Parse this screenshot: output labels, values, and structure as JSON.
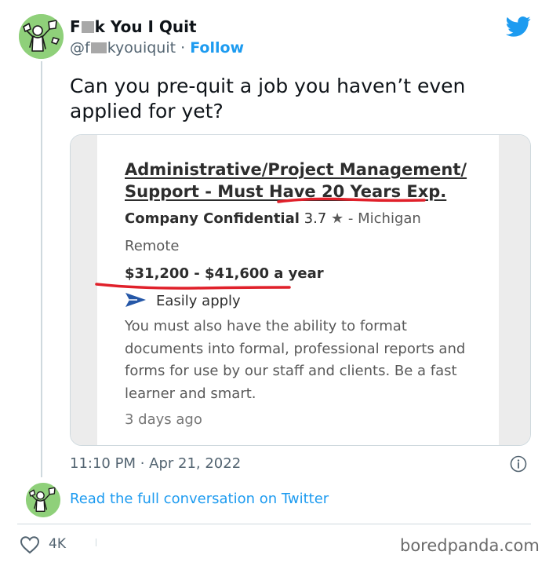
{
  "tweet": {
    "display_name": {
      "before": "F",
      "after": "k You I Quit"
    },
    "handle": {
      "before": "@f",
      "after": "kyouiquit"
    },
    "separator": " · ",
    "follow_label": "Follow",
    "text": "Can you pre-quit a job you haven’t even applied for yet?",
    "timestamp": "11:10 PM · Apr 21, 2022",
    "read_more": "Read the full conversation on Twitter",
    "likes": "4K"
  },
  "job_card": {
    "title": "Administrative/Project Management/ Support - Must Have 20 Years Exp.",
    "company": "Company Confidential",
    "rating": "3.7",
    "location": "- Michigan",
    "work_type": "Remote",
    "salary": "$31,200 - $41,600 a year",
    "apply_label": "Easily apply",
    "description": "You must also have the ability to format documents into formal, professional reports and forms for use by our staff and clients. Be a fast learner and smart.",
    "posted": "3 days ago"
  },
  "watermark": "boredpanda.com",
  "colors": {
    "twitter_blue": "#1d9bf0",
    "avatar_green": "#8fd07a",
    "highlight_red": "#e0202a",
    "apply_arrow": "#2557a7"
  },
  "icons": {
    "brand": "twitter-bird-icon",
    "info": "info-icon",
    "like": "heart-icon",
    "rating": "star-icon",
    "apply": "send-arrow-icon"
  }
}
